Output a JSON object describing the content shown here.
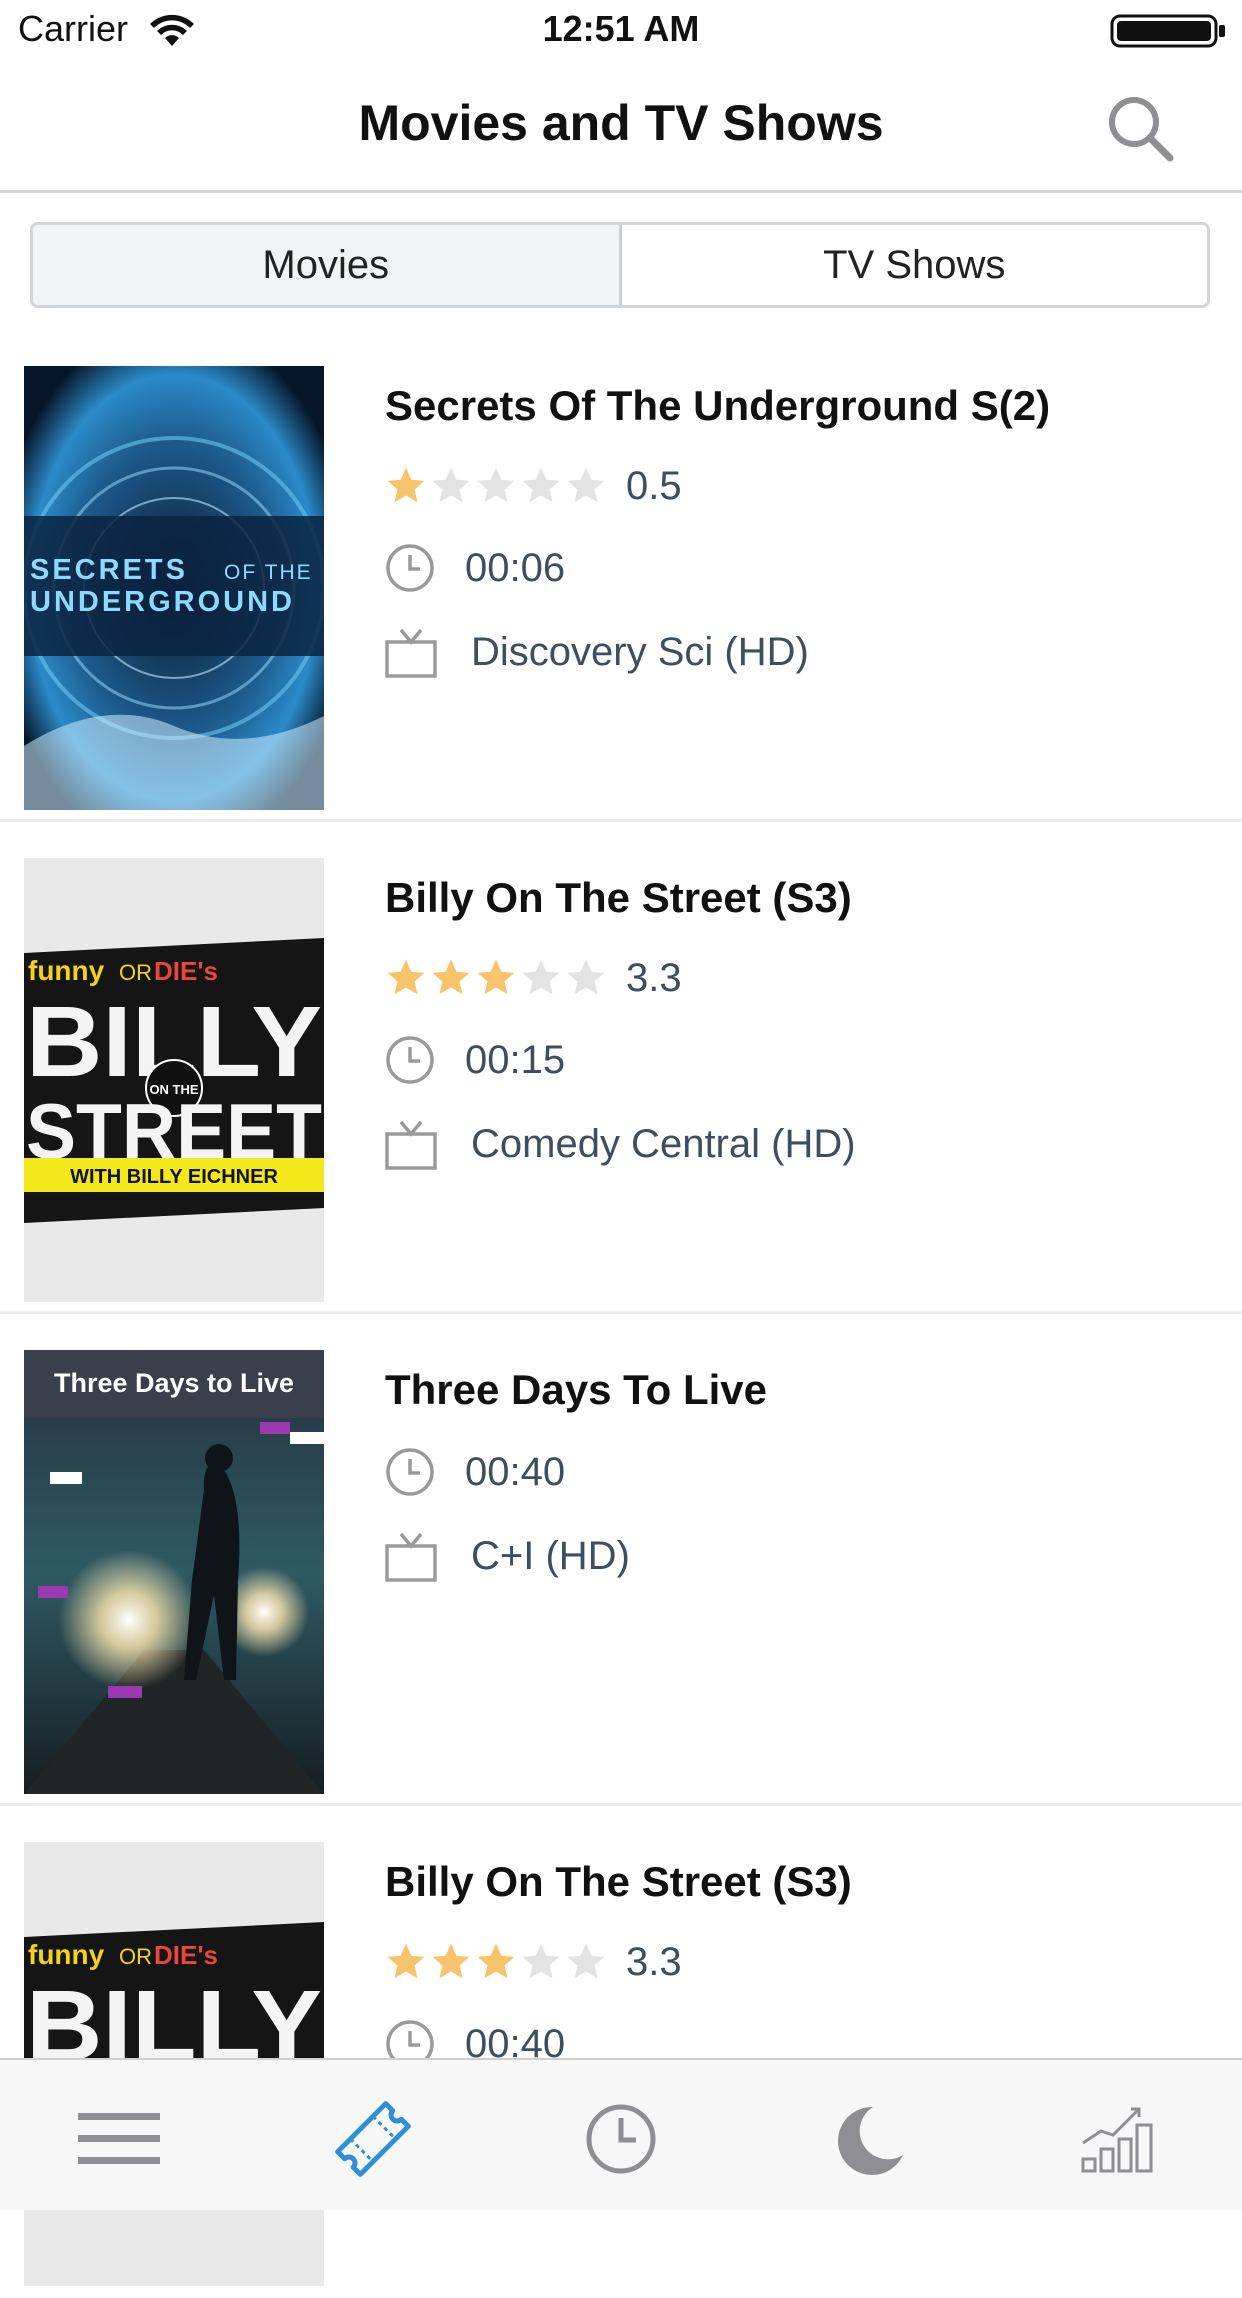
{
  "status_bar": {
    "carrier": "Carrier",
    "time": "12:51 AM"
  },
  "nav": {
    "title": "Movies and TV Shows"
  },
  "segments": {
    "movies": "Movies",
    "tv_shows": "TV Shows",
    "selected": "Movies"
  },
  "items": [
    {
      "title": "Secrets Of The Underground S(2)",
      "rating": "0.5",
      "rating_value": 0.5,
      "duration": "00:06",
      "channel": "Discovery Sci (HD)",
      "poster": {
        "line1": "SECRETS",
        "line1b": "OF THE",
        "line2": "UNDERGROUND"
      }
    },
    {
      "title": "Billy On The Street (S3)",
      "rating": "3.3",
      "rating_value": 3.3,
      "duration": "00:15",
      "channel": "Comedy Central (HD)",
      "poster": {
        "top": "funny",
        "or": "OR",
        "die": "DIE's",
        "big1": "BILLY",
        "mid": "ON THE",
        "big2": "STREET",
        "bottom": "WITH BILLY EICHNER"
      }
    },
    {
      "title": "Three Days To Live",
      "duration": "00:40",
      "channel": "C+I (HD)",
      "poster": {
        "caption": "Three Days to Live"
      }
    },
    {
      "title": "Billy On The Street (S3)",
      "rating": "3.3",
      "rating_value": 3.3,
      "duration": "00:40",
      "poster": {
        "top": "funny",
        "or": "OR",
        "die": "DIE's",
        "big1": "BILLY"
      }
    }
  ],
  "colors": {
    "accent": "#2f8fd8",
    "star_on": "#f7c46c",
    "star_off": "#e3e3e3",
    "meta_text": "#3d4f5f"
  },
  "tabs": [
    {
      "icon": "menu-icon"
    },
    {
      "icon": "ticket-icon",
      "active": true
    },
    {
      "icon": "clock-icon"
    },
    {
      "icon": "moon-icon"
    },
    {
      "icon": "chart-icon"
    }
  ]
}
